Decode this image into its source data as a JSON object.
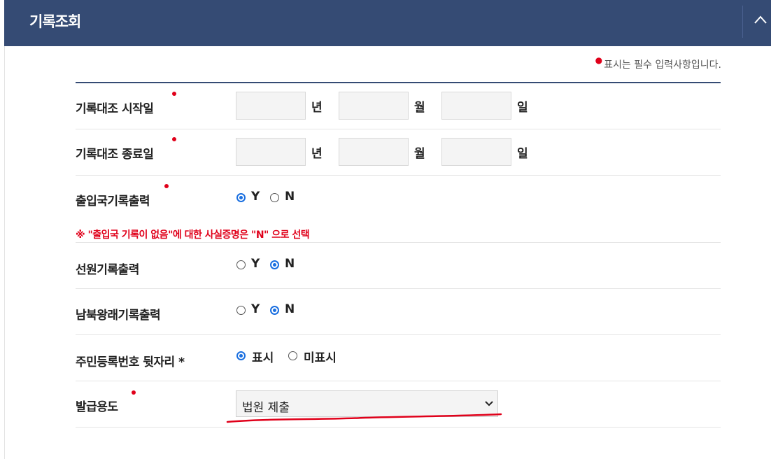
{
  "panel": {
    "title": "기록조회",
    "collapse_icon": "chevron-up-icon"
  },
  "required_note": "표시는 필수 입력사항입니다.",
  "start_date": {
    "label": "기록대조 시작일",
    "year_unit": "년",
    "month_unit": "월",
    "day_unit": "일",
    "year": "",
    "month": "",
    "day": ""
  },
  "end_date": {
    "label": "기록대조 종료일",
    "year_unit": "년",
    "month_unit": "월",
    "day_unit": "일",
    "year": "",
    "month": "",
    "day": ""
  },
  "immigration": {
    "label": "출입국기록출력",
    "opt_y": "Y",
    "opt_n": "N",
    "selected": "Y"
  },
  "warning": "※ \"출입국 기록이 없음\"에 대한 사실증명은 \"N\" 으로 선택",
  "seaman": {
    "label": "선원기록출력",
    "opt_y": "Y",
    "opt_n": "N",
    "selected": "N"
  },
  "north_south": {
    "label": "남북왕래기록출력",
    "opt_y": "Y",
    "opt_n": "N",
    "selected": "N"
  },
  "rrn": {
    "label": "주민등록번호 뒷자리 *",
    "opt_show": "표시",
    "opt_hide": "미표시",
    "selected": "표시"
  },
  "purpose": {
    "label": "발급용도",
    "selected": "법원 제출"
  },
  "colors": {
    "header": "#354b74",
    "required": "#e0001a",
    "radio": "#1a6fe0"
  }
}
